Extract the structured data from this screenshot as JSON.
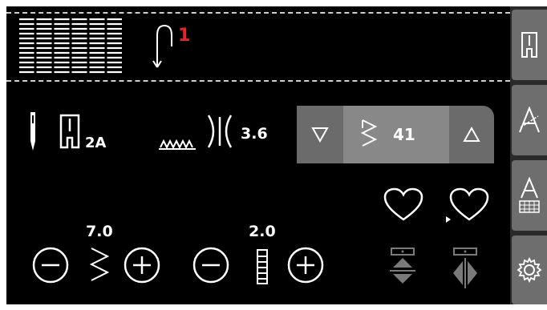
{
  "sequence": {
    "count_label": "1"
  },
  "info_bar": {
    "foot_label": "2A",
    "stitch_number": "41",
    "tension_value": "3.6"
  },
  "controls": {
    "width_value": "7.0",
    "length_value": "2.0"
  },
  "colors": {
    "accent_red": "#e0262c",
    "panel_gray": "#6b6b6b",
    "sidebar_button": "#6e6e6e"
  },
  "icons": [
    "stitch-program-icon",
    "thread-path-icon",
    "needle-icon",
    "presser-foot-icon",
    "feed-dogs-icon",
    "tension-icon",
    "arrow-down-icon",
    "zigzag-stitch-icon",
    "arrow-up-icon",
    "heart-icon",
    "heart-arrow-icon",
    "minus-icon",
    "plus-icon",
    "zigzag-width-icon",
    "length-bar-icon",
    "mirror-vertical-icon",
    "mirror-horizontal-icon",
    "presser-foot-tab-icon",
    "font-tab-icon",
    "font-keyboard-tab-icon",
    "settings-gear-icon"
  ]
}
